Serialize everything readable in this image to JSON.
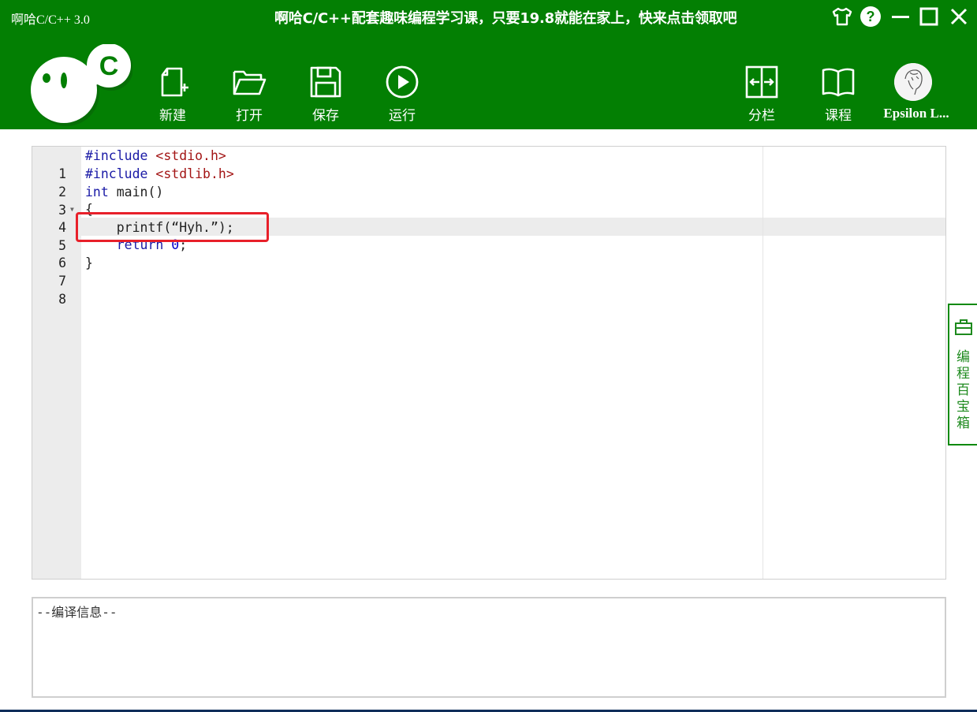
{
  "app": {
    "title": "啊哈C/C++ 3.0",
    "promo": "啊哈C/C++配套趣味编程学习课，只要19.8就能在家上，快来点击领取吧"
  },
  "window_controls": [
    {
      "name": "skin-icon"
    },
    {
      "name": "help-icon"
    },
    {
      "name": "minimize-icon"
    },
    {
      "name": "maximize-icon"
    },
    {
      "name": "close-icon"
    }
  ],
  "logo": {
    "letter": "C"
  },
  "toolbar": {
    "new": "新建",
    "open": "打开",
    "save": "保存",
    "run": "运行",
    "split": "分栏",
    "course": "课程"
  },
  "user": {
    "name": "Epsilon L..."
  },
  "editor": {
    "line_numbers": [
      "1",
      "2",
      "3",
      "4",
      "5",
      "6",
      "7",
      "8"
    ],
    "lines": [
      {
        "a": "#include",
        "b": " ",
        "c": "<stdio.h>"
      },
      {
        "a": "#include",
        "b": " ",
        "c": "<stdlib.h>"
      },
      {
        "a": "int",
        "b": " main()"
      },
      {
        "a": "{"
      },
      {
        "a": "    printf(“Hyh.”);"
      },
      {
        "a": "    return",
        "b": " ",
        "c": "0",
        "d": ";"
      },
      {
        "a": "}"
      },
      {
        "a": ""
      }
    ],
    "active_line": 5,
    "fold_marker": "▼"
  },
  "toolbox": {
    "label_chars": [
      "编",
      "程",
      "百",
      "宝",
      "箱"
    ]
  },
  "compile": {
    "title": "--编译信息--"
  },
  "colors": {
    "header": "#037f03",
    "keyword": "#1a1aa6",
    "string": "#a31515",
    "highlight": "#e8202a"
  }
}
